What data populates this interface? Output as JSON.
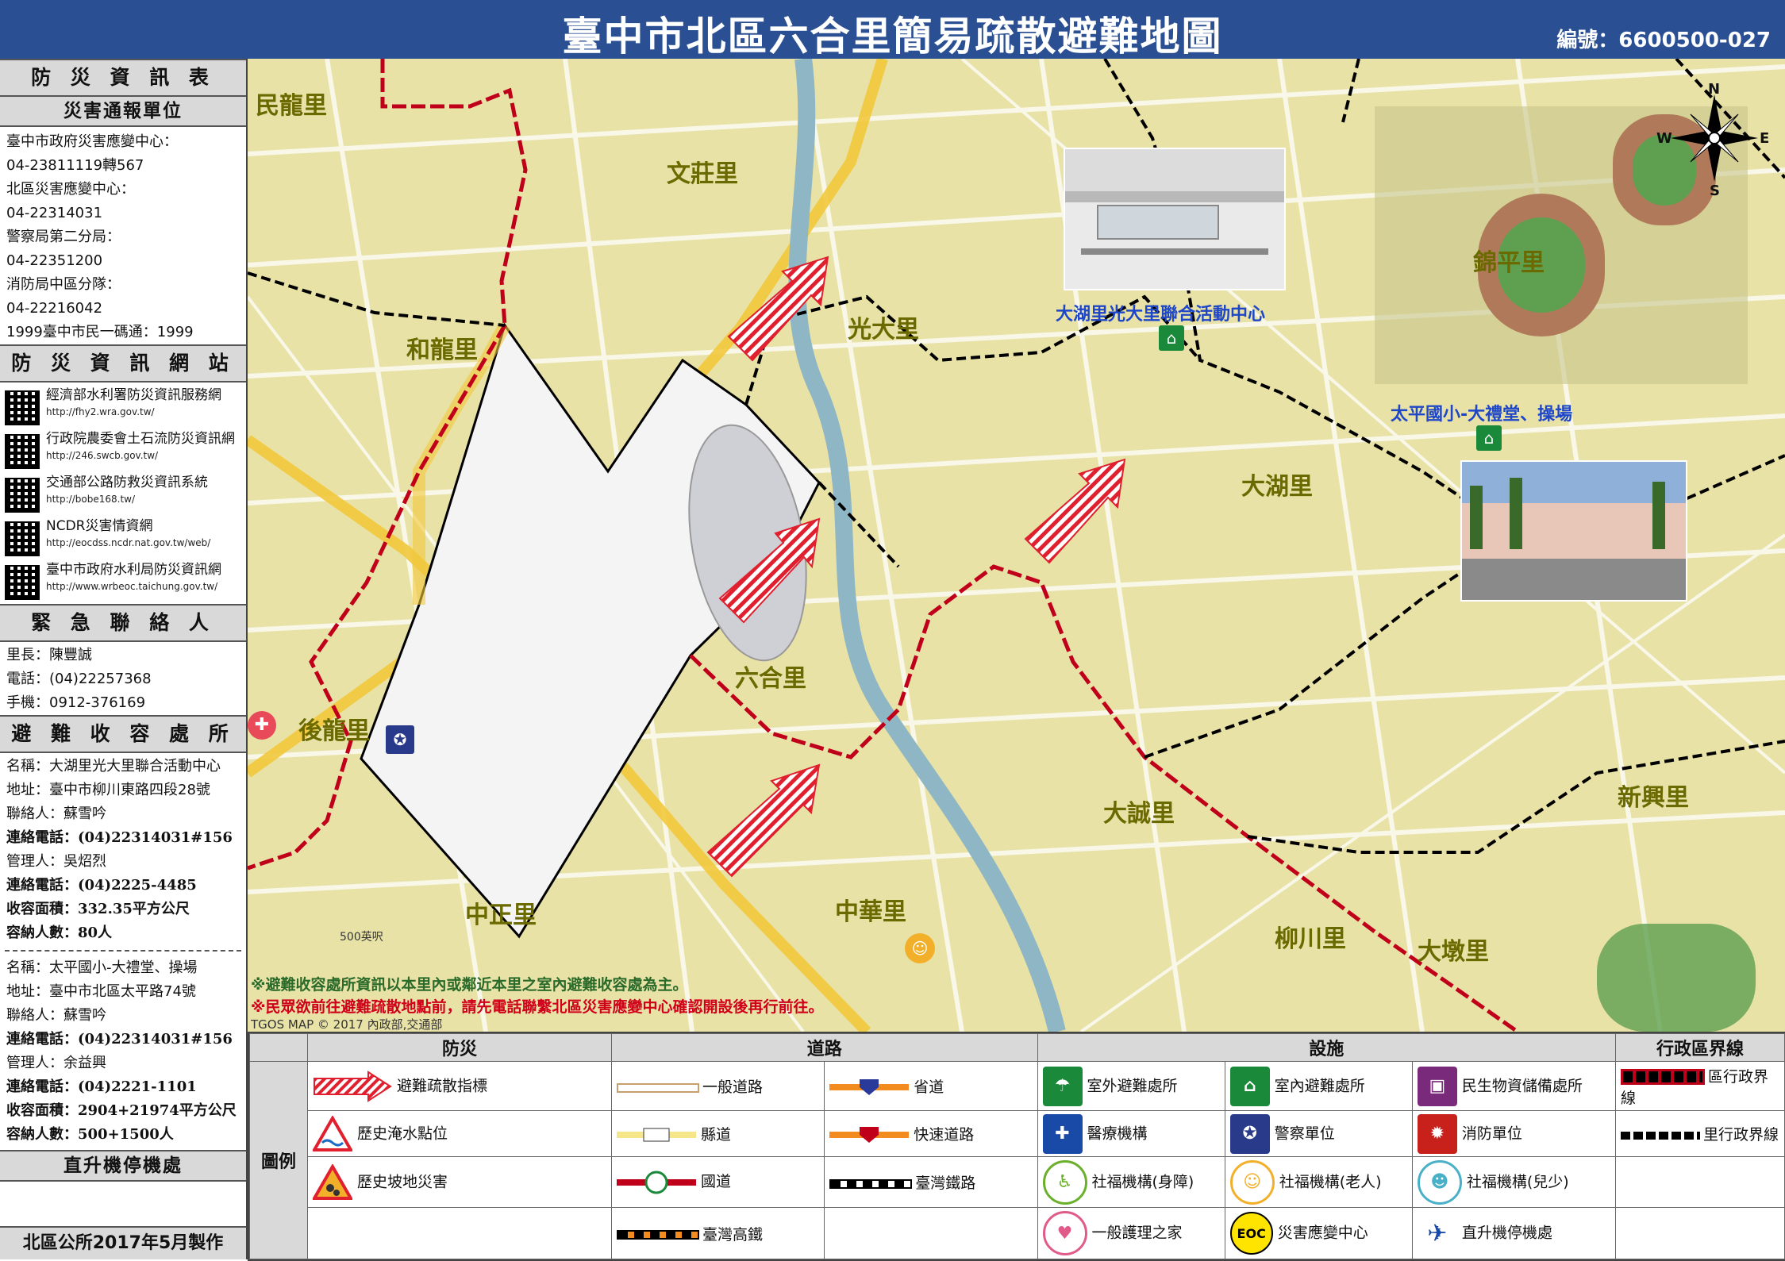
{
  "title": "臺中市北區六合里簡易疏散避難地圖",
  "code": "編號：6600500-027",
  "sidebar": {
    "info_title": "防 災 資 訊 表",
    "report_title": "災害通報單位",
    "report_lines": [
      "臺中市政府災害應變中心：",
      "04-23811119轉567",
      "北區災害應變中心：",
      "04-22314031",
      "警察局第二分局：",
      "04-22351200",
      "消防局中區分隊：",
      "04-22216042",
      "1999臺中市民一碼通：1999"
    ],
    "web_title": "防 災 資 訊 網 站",
    "websites": [
      {
        "name": "經濟部水利署防災資訊服務網",
        "url": "http://fhy2.wra.gov.tw/"
      },
      {
        "name": "行政院農委會土石流防災資訊網",
        "url": "http://246.swcb.gov.tw/"
      },
      {
        "name": "交通部公路防救災資訊系統",
        "url": "http://bobe168.tw/"
      },
      {
        "name": "NCDR災害情資網",
        "url": "http://eocdss.ncdr.nat.gov.tw/web/"
      },
      {
        "name": "臺中市政府水利局防災資訊網",
        "url": "http://www.wrbeoc.taichung.gov.tw/"
      }
    ],
    "contact_title": "緊 急 聯 絡 人",
    "contact_lines": [
      "里長：陳豐誠",
      "電話：(04)22257368",
      "手機：0912-376169"
    ],
    "shelter_title": "避 難 收 容 處 所",
    "shelter1": [
      "名稱：大湖里光大里聯合活動中心",
      "地址：臺中市柳川東路四段28號",
      "聯絡人：蘇雪吟",
      "連絡電話：(04)22314031#156",
      "管理人：吳炤烈",
      "連絡電話：(04)2225-4485",
      "收容面積：332.35平方公尺",
      "容納人數：80人"
    ],
    "shelter2": [
      "名稱：太平國小-大禮堂、操場",
      "地址：臺中市北區太平路74號",
      "聯絡人：蘇雪吟",
      "連絡電話：(04)22314031#156",
      "管理人：余益興",
      "連絡電話：(04)2221-1101",
      "收容面積：2904+21974平方公尺",
      "容納人數：500+1500人"
    ],
    "heli_title": "直升機停機處",
    "footer": "北區公所2017年5月製作"
  },
  "map": {
    "villages": {
      "minlong": "民龍里",
      "wenzhuang": "文莊里",
      "guangda": "光大里",
      "helong": "和龍里",
      "jinping": "錦平里",
      "dahu": "大湖里",
      "liuhe": "六合里",
      "houlong": "後龍里",
      "dacheng": "大誠里",
      "xinxing": "新興里",
      "zhongzheng": "中正里",
      "zhonghua": "中華里",
      "liuchuan": "柳川里",
      "dadun": "大墩里"
    },
    "shelter1_label": "大湖里光大里聯合活動中心",
    "shelter2_label": "太平國小-大禮堂、操場",
    "compass": {
      "n": "N",
      "s": "S",
      "e": "E",
      "w": "W"
    },
    "notes": [
      "※避難收容處所資訊以本里內或鄰近本里之室內避難收容處為主。",
      "※民眾欲前往避難疏散地點前，請先電話聯繫北區災害應變中心確認開設後再行前往。"
    ],
    "copyright": "TGOS MAP © 2017 內政部,交通部",
    "scale": "500英呎"
  },
  "legend": {
    "row_label": "圖例",
    "headers": {
      "disaster": "防災",
      "road": "道路",
      "facility": "設施",
      "boundary": "行政區界線"
    },
    "disaster": [
      "避難疏散指標",
      "歷史淹水點位",
      "歷史坡地災害"
    ],
    "roads": {
      "general": "一般道路",
      "provincial": "省道",
      "county": "縣道",
      "expressway": "快速道路",
      "national": "國道",
      "railway": "臺灣鐵路",
      "hsr": "臺灣高鐵"
    },
    "facilities": {
      "outdoor": "室外避難處所",
      "indoor": "室內避難處所",
      "supplies": "民生物資儲備處所",
      "medical": "醫療機構",
      "police": "警察單位",
      "fire": "消防單位",
      "welfare_disabled": "社福機構(身障)",
      "welfare_elderly": "社福機構(老人)",
      "welfare_youth": "社福機構(兒少)",
      "nursing": "一般護理之家",
      "eoc": "災害應變中心",
      "heli": "直升機停機處"
    },
    "boundary": {
      "district": "區行政界線",
      "village": "里行政界線"
    },
    "eoc_mark": "EOC"
  },
  "colors": {
    "title_bg": "#2a4f93",
    "map_bg": "#e8e2a6",
    "liuhe_fill": "#f4f4f4",
    "district_line": "#c0001a",
    "village_line": "#000000",
    "label": "#6b6a00"
  }
}
